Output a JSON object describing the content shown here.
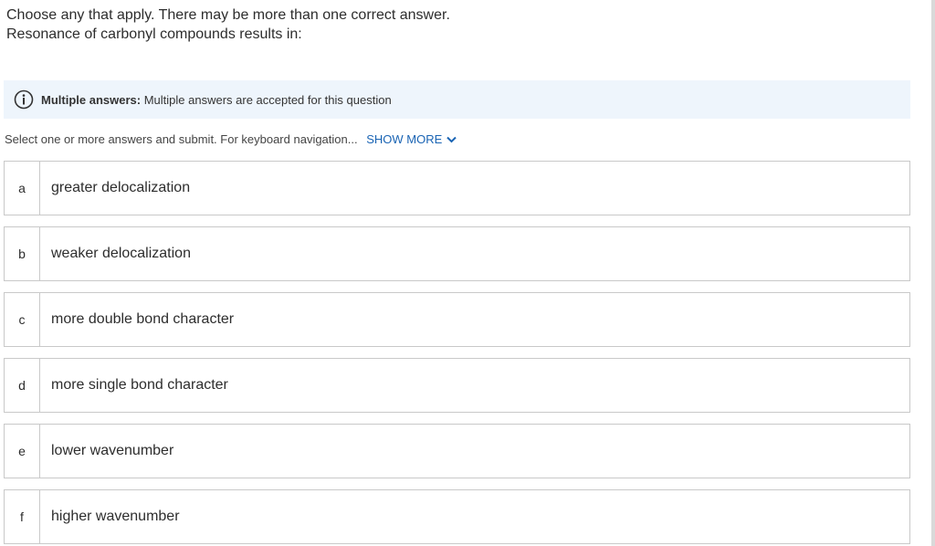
{
  "prompt": {
    "line1": "Choose any that apply. There may be more than one correct answer.",
    "line2": "Resonance of carbonyl compounds results in:"
  },
  "info": {
    "icon": "info-circle-icon",
    "label": "Multiple answers:",
    "text": "Multiple answers are accepted for this question",
    "color": "#eef5fc"
  },
  "instructions": {
    "text": "Select one or more answers and submit. For keyboard navigation...",
    "show_more": "SHOW MORE",
    "show_more_icon": "chevron-down-icon",
    "link_color": "#1a64b4"
  },
  "options": [
    {
      "letter": "a",
      "text": "greater delocalization"
    },
    {
      "letter": "b",
      "text": "weaker delocalization"
    },
    {
      "letter": "c",
      "text": "more double bond character"
    },
    {
      "letter": "d",
      "text": "more single bond character"
    },
    {
      "letter": "e",
      "text": "lower wavenumber"
    },
    {
      "letter": "f",
      "text": "higher wavenumber"
    }
  ]
}
